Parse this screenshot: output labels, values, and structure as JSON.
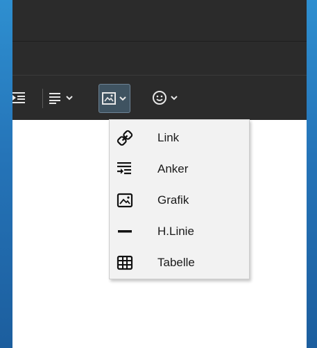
{
  "toolbar": {
    "align_button": "align-dropdown",
    "insert_image_button": "insert-dropdown",
    "emoji_button": "emoji-dropdown"
  },
  "insert_menu": {
    "items": [
      {
        "label": "Link",
        "icon": "link-icon"
      },
      {
        "label": "Anker",
        "icon": "anchor-icon"
      },
      {
        "label": "Grafik",
        "icon": "image-icon"
      },
      {
        "label": "H.Linie",
        "icon": "horizontal-line-icon"
      },
      {
        "label": "Tabelle",
        "icon": "table-icon"
      }
    ]
  },
  "colors": {
    "desktop": "#2574b8",
    "toolbar_bg": "#2b2b2b",
    "active_button": "#3f5361",
    "menu_bg": "#f2f2f2"
  }
}
